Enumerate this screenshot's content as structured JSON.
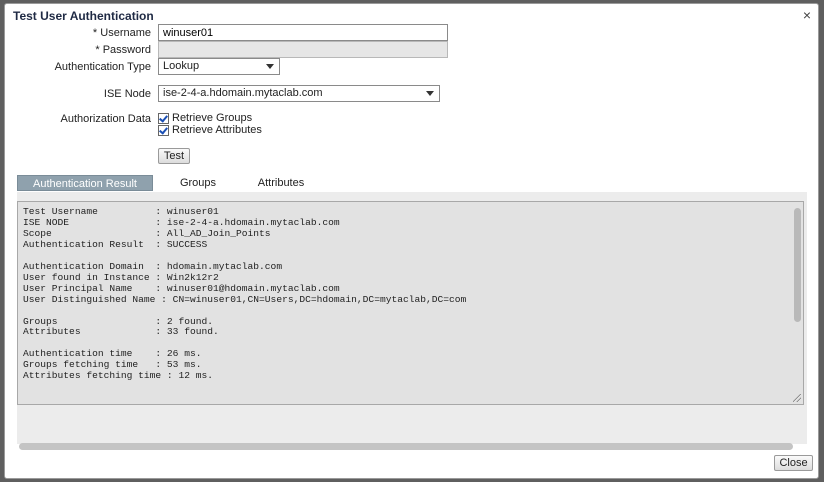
{
  "dialog": {
    "title": "Test User Authentication",
    "close_symbol": "×"
  },
  "form": {
    "username": {
      "label": "* Username",
      "value": "winuser01"
    },
    "password": {
      "label": "* Password",
      "value": ""
    },
    "auth_type": {
      "label": "Authentication Type",
      "value": "Lookup"
    },
    "ise_node": {
      "label": "ISE Node",
      "value": "ise-2-4-a.hdomain.mytaclab.com"
    },
    "authz": {
      "label": "Authorization Data",
      "retrieve_groups": "Retrieve Groups",
      "retrieve_attributes": "Retrieve Attributes"
    },
    "test_label": "Test"
  },
  "tabs": [
    {
      "label": "Authentication Result",
      "active": true
    },
    {
      "label": "Groups",
      "active": false
    },
    {
      "label": "Attributes",
      "active": false
    }
  ],
  "result_lines": [
    "Test Username          : winuser01",
    "ISE NODE               : ise-2-4-a.hdomain.mytaclab.com",
    "Scope                  : All_AD_Join_Points",
    "Authentication Result  : SUCCESS",
    "",
    "Authentication Domain  : hdomain.mytaclab.com",
    "User found in Instance : Win2k12r2",
    "User Principal Name    : winuser01@hdomain.mytaclab.com",
    "User Distinguished Name : CN=winuser01,CN=Users,DC=hdomain,DC=mytaclab,DC=com",
    "",
    "Groups                 : 2 found.",
    "Attributes             : 33 found.",
    "",
    "Authentication time    : 26 ms.",
    "Groups fetching time   : 53 ms.",
    "Attributes fetching time : 12 ms."
  ],
  "footer": {
    "close_label": "Close"
  }
}
